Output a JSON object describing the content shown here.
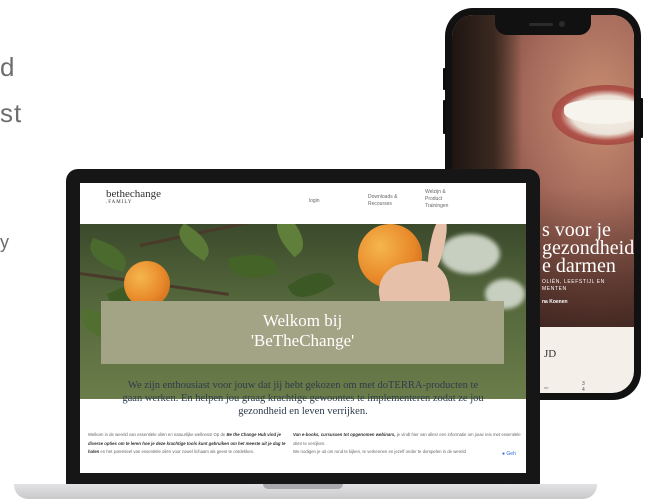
{
  "background_text": {
    "line1": "d",
    "line2": "st",
    "line3": "y"
  },
  "phone": {
    "headline_line1": "s voor je",
    "headline_line2": "gezondheid",
    "headline_line3": "e darmen",
    "subline1": "OLIËN, LEEFSTIJL EN",
    "subline2": "MENTEN",
    "author": "na Koenen",
    "bottom_title": "JD",
    "bottom_num1": "3",
    "bottom_num2": "4",
    "bottom_small": "ne"
  },
  "site": {
    "logo_main": "bethechange",
    "logo_sub": ".FAMILY",
    "nav": {
      "login": "login",
      "downloads_line1": "Downloads &",
      "downloads_line2": "Recourses",
      "welzijn_line1": "Welzijn &",
      "welzijn_line2": "Product",
      "welzijn_line3": "Trainingen"
    },
    "hero_title_line1": "Welkom bij",
    "hero_title_line2": "'BeTheChange'",
    "intro_text": "We zijn enthousiast voor jouw dat jij hebt gekozen om met doTERRA-producten te gaan werken. En helpen jou graag krachtige gewoontes te implementeren zodat ze jou gezondheid en leven verrijken.",
    "body_left_plain1": "Welkom in de wereld van essentiële oliën en natuurlijke wellness! Op de ",
    "body_left_bold1": "Be the Change Hub vind je diverse opties om te leren hoe je deze krachtige tools kunt gebruiken om het meeste uit je dag te halen",
    "body_left_plain2": " en het potentieel van essentiële oliën voor zowel lichaam als geest te ontdekken.",
    "body_right_bold1": "Van e-books, cursussen tot opgenomen webinars,",
    "body_right_plain1": " je vindt hier van alles! een informatie om jouw reis met essentiële oliën te verrijken.",
    "body_right_plain2": "We nodigen je uit om rond te kijken, te verkennen en jezelf onder te dompelen in de wereld",
    "chat_label": "Geh"
  },
  "colors": {
    "welcome_box": "#a3a385",
    "intro_text": "#2d3b4c",
    "hero_green": "#55683c",
    "orange": "#e8892a"
  }
}
